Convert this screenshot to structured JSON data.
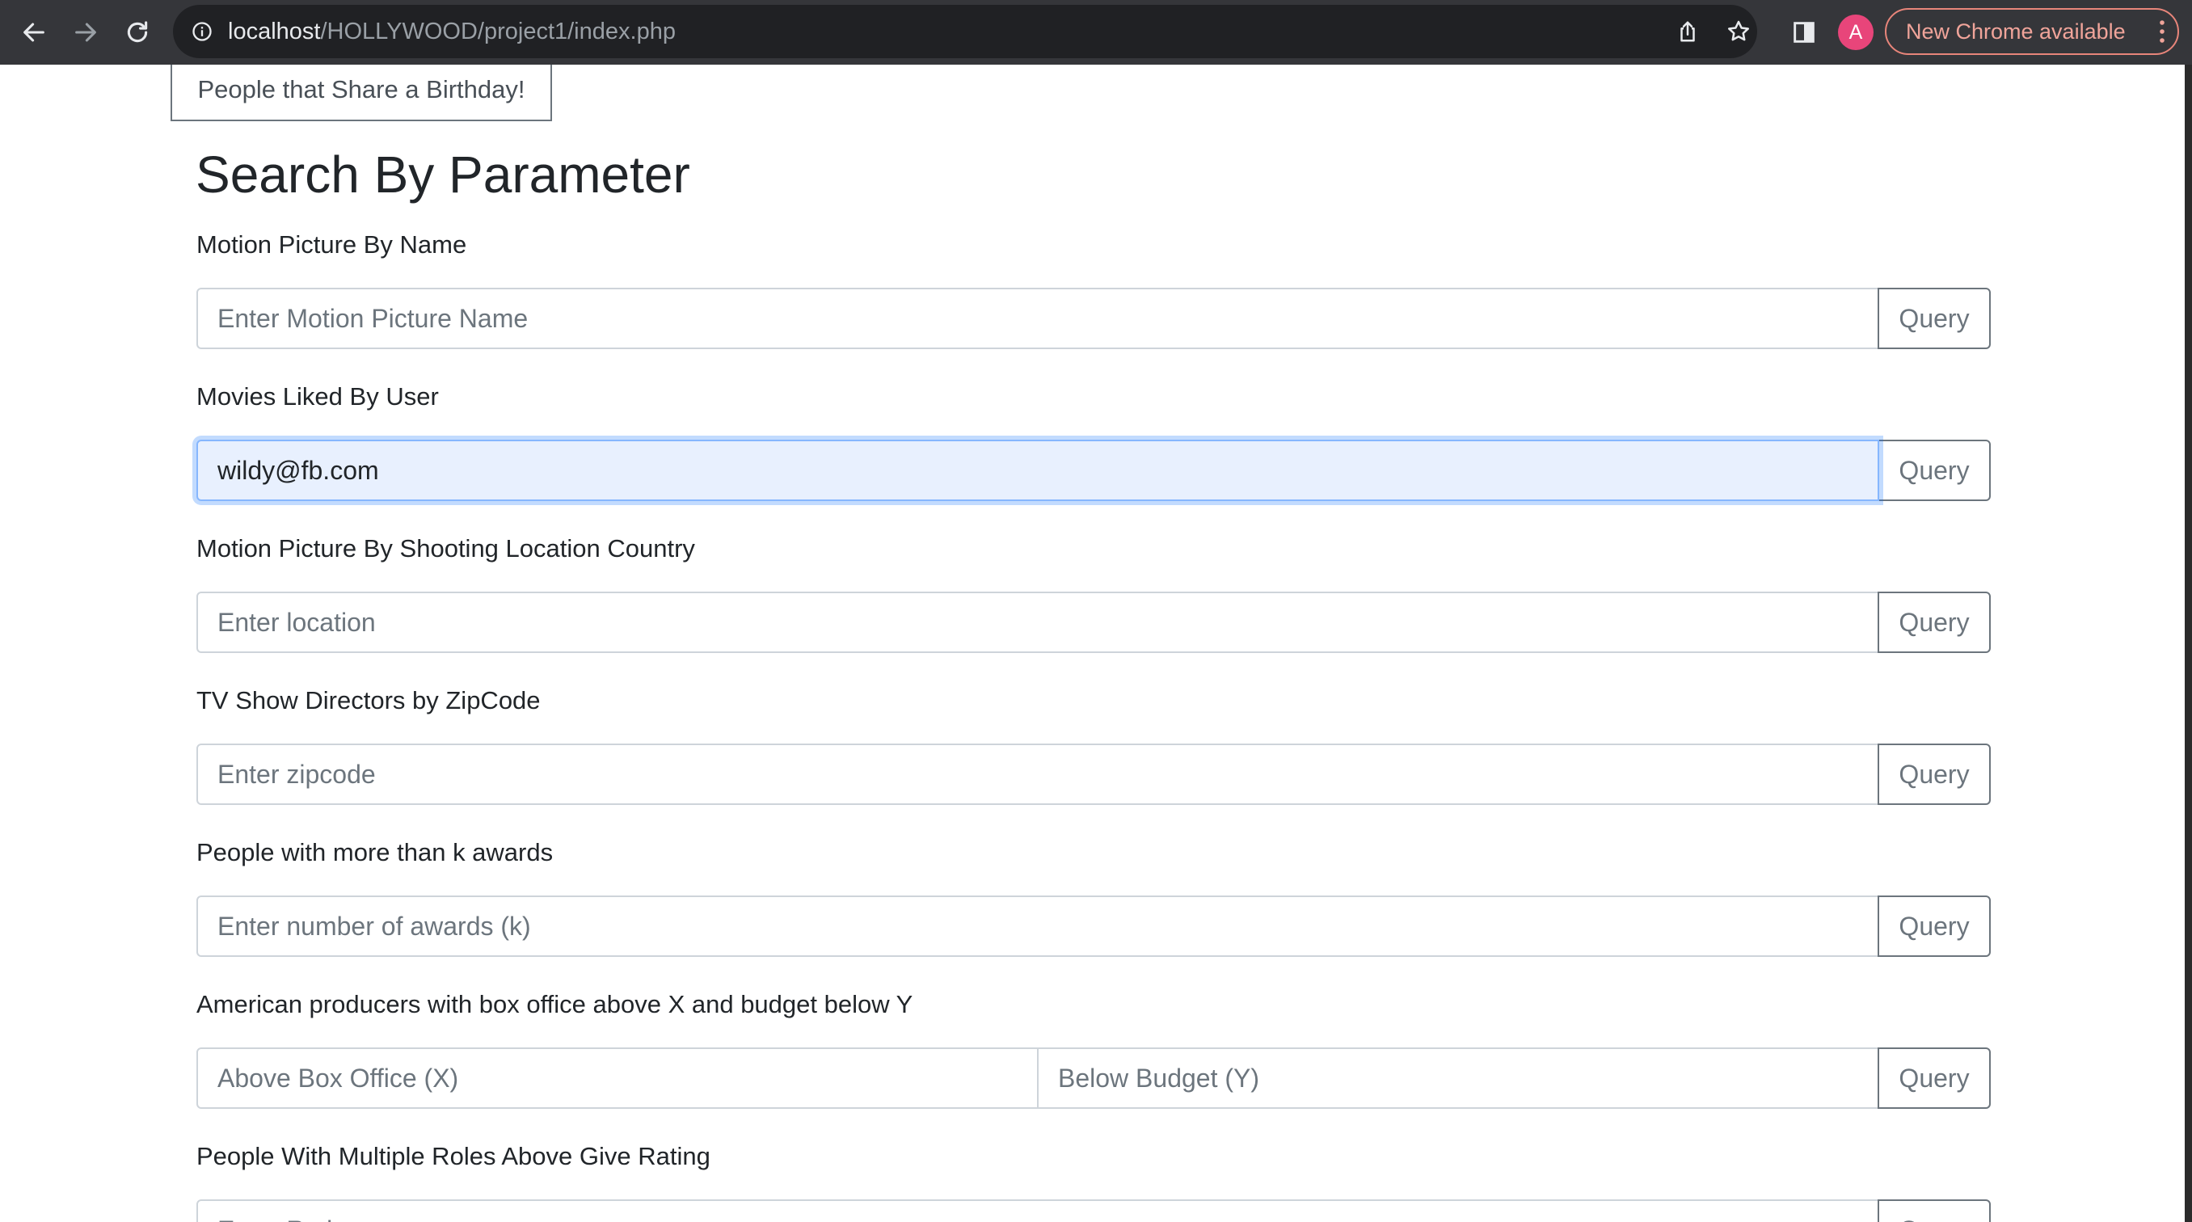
{
  "browser": {
    "url_host": "localhost",
    "url_path": "/HOLLYWOOD/project1/index.php",
    "profile_initial": "A",
    "update_label": "New Chrome available"
  },
  "page": {
    "top_button": "People that Share a Birthday!",
    "heading": "Search By Parameter",
    "query_label": "Query",
    "sections": [
      {
        "label": "Motion Picture By Name",
        "placeholder": "Enter Motion Picture Name",
        "value": ""
      },
      {
        "label": "Movies Liked By User",
        "placeholder": "",
        "value": "wildy@fb.com"
      },
      {
        "label": "Motion Picture By Shooting Location Country",
        "placeholder": "Enter location",
        "value": ""
      },
      {
        "label": "TV Show Directors by ZipCode",
        "placeholder": "Enter zipcode",
        "value": ""
      },
      {
        "label": "People with more than k awards",
        "placeholder": "Enter number of awards (k)",
        "value": ""
      },
      {
        "label": "American producers with box office above X and budget below Y",
        "placeholder_x": "Above Box Office (X)",
        "placeholder_y": "Below Budget (Y)"
      },
      {
        "label": "People With Multiple Roles Above Give Rating",
        "placeholder": "Enter Rating"
      }
    ]
  },
  "colors": {
    "toolbar": "#35363a",
    "omnibox": "#202124",
    "focus_fill": "#e8f0fe",
    "button_border": "#6c757d",
    "avatar": "#e8457a",
    "update_accent": "#e8857a"
  },
  "icons": [
    "back-icon",
    "forward-icon",
    "reload-icon",
    "site-info-icon",
    "share-icon",
    "bookmark-star-icon",
    "side-panel-icon",
    "kebab-menu-icon"
  ]
}
